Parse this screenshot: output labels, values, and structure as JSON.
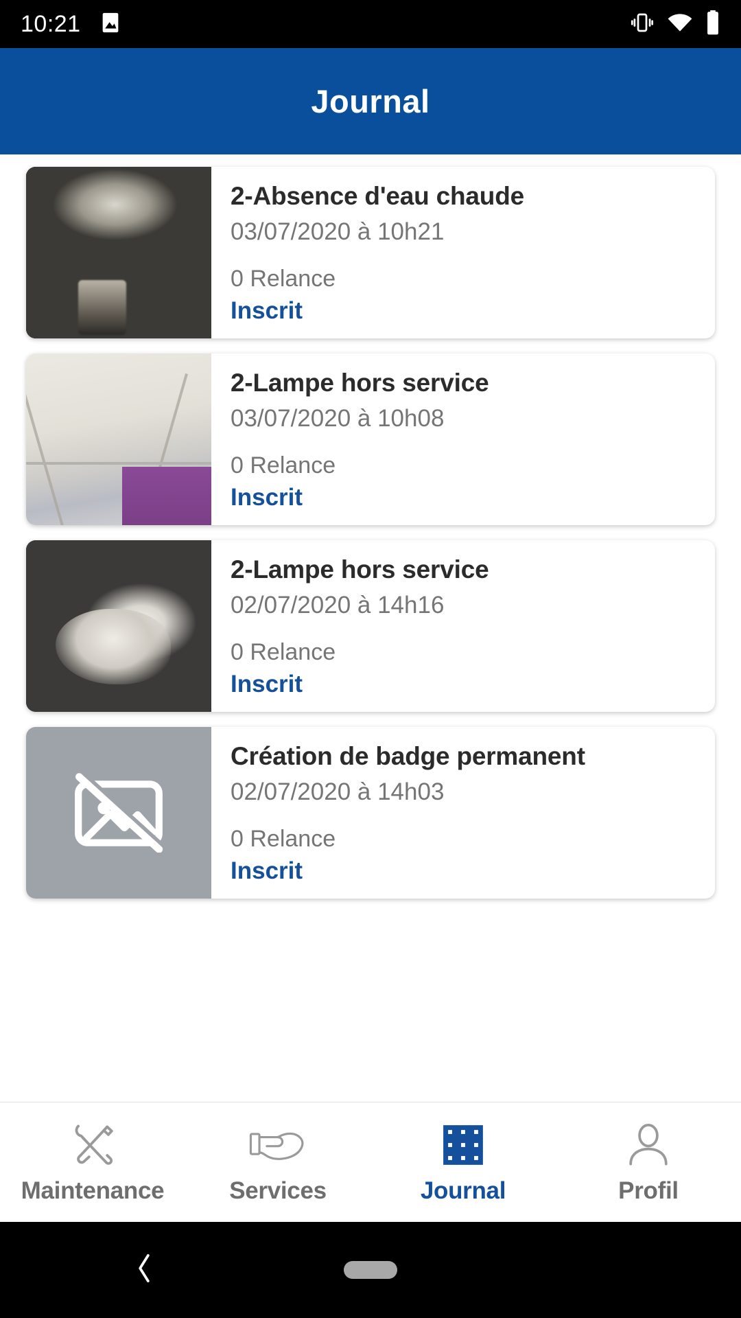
{
  "status_bar": {
    "time": "10:21",
    "icons": [
      "image-icon",
      "vibrate-icon",
      "wifi-icon",
      "battery-icon"
    ]
  },
  "header": {
    "title": "Journal",
    "background_color": "#0a4f9c",
    "text_color": "#ffffff"
  },
  "colors": {
    "accent_blue": "#14509c",
    "header_blue": "#0a4f9c",
    "muted_text": "#757575",
    "title_text": "#2b2b2b",
    "placeholder_gray": "#9ea2a9"
  },
  "list": {
    "relance_suffix": "Relance",
    "items": [
      {
        "title": "2-Absence d'eau chaude",
        "date": "03/07/2020 à 10h21",
        "relance": "0 Relance",
        "status": "Inscrit",
        "thumb": "faucet-photo"
      },
      {
        "title": "2-Lampe hors service",
        "date": "03/07/2020 à 10h08",
        "relance": "0 Relance",
        "status": "Inscrit",
        "thumb": "ceiling-photo"
      },
      {
        "title": "2-Lampe hors service",
        "date": "02/07/2020 à 14h16",
        "relance": "0 Relance",
        "status": "Inscrit",
        "thumb": "lamp-photo"
      },
      {
        "title": "Création de badge permanent",
        "date": "02/07/2020 à 14h03",
        "relance": "0 Relance",
        "status": "Inscrit",
        "thumb": "broken-image-placeholder"
      }
    ]
  },
  "tabbar": {
    "active": "Journal",
    "tabs": [
      {
        "label": "Maintenance",
        "icon": "tools-icon"
      },
      {
        "label": "Services",
        "icon": "hand-offer-icon"
      },
      {
        "label": "Journal",
        "icon": "grid-icon"
      },
      {
        "label": "Profil",
        "icon": "person-icon"
      }
    ]
  },
  "android_nav": {
    "back": "back-chevron",
    "home": "home-pill"
  }
}
